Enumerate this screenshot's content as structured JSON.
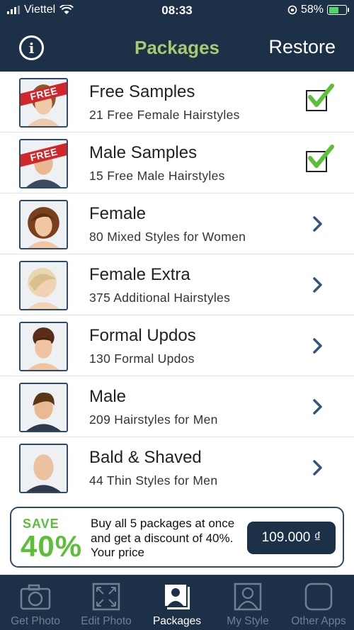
{
  "status_bar": {
    "carrier": "Viettel",
    "time": "08:33",
    "battery": "58%"
  },
  "navbar": {
    "title": "Packages",
    "restore_label": "Restore",
    "info_icon": "info-circle-icon"
  },
  "ribbon_text": "FREE",
  "packages": [
    {
      "title": "Free Samples",
      "subtitle": "21 Free Female Hairstyles",
      "status": "checked"
    },
    {
      "title": "Male Samples",
      "subtitle": "15 Free Male Hairstyles",
      "status": "checked"
    },
    {
      "title": "Female",
      "subtitle": "80 Mixed Styles for Women",
      "status": "chevron"
    },
    {
      "title": "Female Extra",
      "subtitle": "375 Additional Hairstyles",
      "status": "chevron"
    },
    {
      "title": "Formal Updos",
      "subtitle": "130 Formal Updos",
      "status": "chevron"
    },
    {
      "title": "Male",
      "subtitle": "209 Hairstyles for Men",
      "status": "chevron"
    },
    {
      "title": "Bald & Shaved",
      "subtitle": "44 Thin Styles for Men",
      "status": "chevron"
    }
  ],
  "promo": {
    "save_label": "SAVE",
    "percent": "40%",
    "text": "Buy all 5 packages at once and get a discount of 40%. Your price",
    "price": "109.000 ₫"
  },
  "tabs": [
    {
      "label": "Get Photo",
      "icon": "camera-icon",
      "active": false
    },
    {
      "label": "Edit Photo",
      "icon": "resize-icon",
      "active": false
    },
    {
      "label": "Packages",
      "icon": "packages-icon",
      "active": true
    },
    {
      "label": "My Style",
      "icon": "person-icon",
      "active": false
    },
    {
      "label": "Other Apps",
      "icon": "apps-icon",
      "active": false
    }
  ],
  "colors": {
    "header_bg": "#1c3047",
    "title_green": "#a8c96e",
    "check_green": "#5bbf3a",
    "ribbon_red": "#d3262b"
  }
}
